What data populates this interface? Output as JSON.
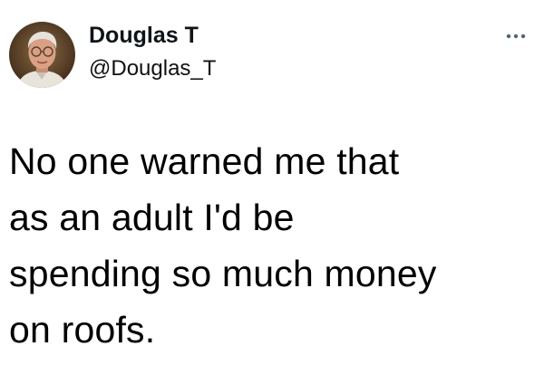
{
  "tweet": {
    "author": {
      "display_name": "Douglas T",
      "handle": "@Douglas_T",
      "avatar_icon": "profile-photo"
    },
    "menu_icon": "more-options-icon",
    "text_lines": [
      "No one warned me that",
      "as an adult I'd be",
      "spending so much money",
      "on roofs."
    ]
  },
  "colors": {
    "background": "#ffffff",
    "text": "#0f1419"
  }
}
